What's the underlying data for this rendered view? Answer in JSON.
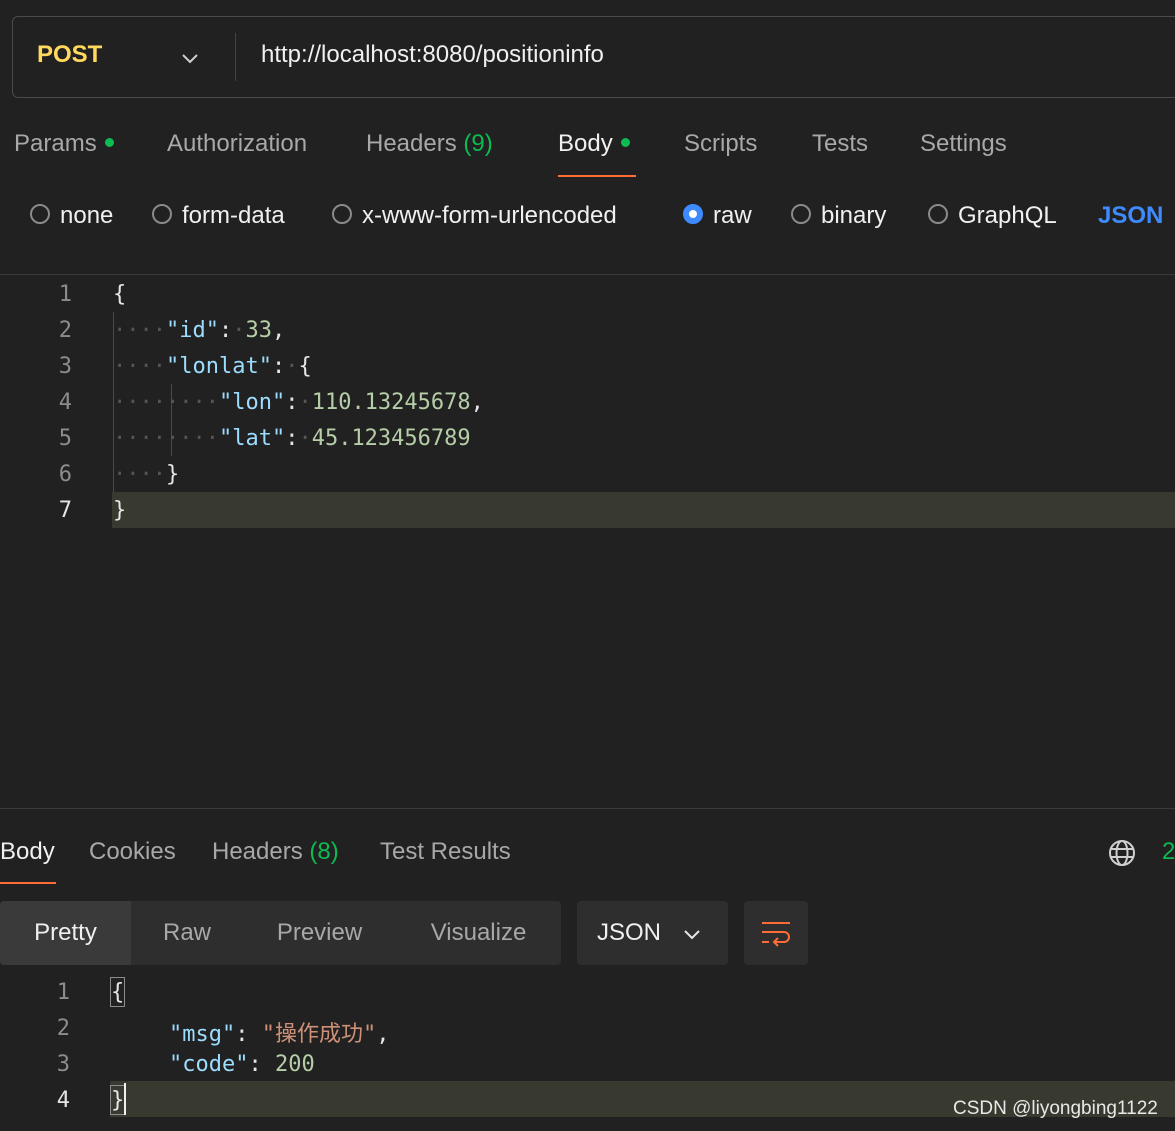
{
  "request": {
    "method": "POST",
    "url": "http://localhost:8080/positioninfo"
  },
  "request_tabs": [
    {
      "label": "Params",
      "dot": true
    },
    {
      "label": "Authorization"
    },
    {
      "label": "Headers",
      "count": "(9)"
    },
    {
      "label": "Body",
      "dot": true,
      "active": true
    },
    {
      "label": "Scripts"
    },
    {
      "label": "Tests"
    },
    {
      "label": "Settings"
    }
  ],
  "body_types": {
    "none": "none",
    "form_data": "form-data",
    "urlencoded": "x-www-form-urlencoded",
    "raw": "raw",
    "binary": "binary",
    "graphql": "GraphQL",
    "selected": "raw",
    "language": "JSON"
  },
  "request_body": {
    "line_numbers": [
      "1",
      "2",
      "3",
      "4",
      "5",
      "6",
      "7"
    ],
    "open_brace": "{",
    "close_brace": "}",
    "key_id": "\"id\"",
    "val_id": "33",
    "key_lonlat": "\"lonlat\"",
    "key_lon": "\"lon\"",
    "val_lon": "110.13245678",
    "key_lat": "\"lat\"",
    "val_lat": "45.123456789"
  },
  "response_tabs": [
    {
      "label": "Body",
      "active": true
    },
    {
      "label": "Cookies"
    },
    {
      "label": "Headers",
      "count": "(8)"
    },
    {
      "label": "Test Results"
    }
  ],
  "status_partial": "2",
  "view_modes": [
    "Pretty",
    "Raw",
    "Preview",
    "Visualize"
  ],
  "response_format": "JSON",
  "response_body": {
    "line_numbers": [
      "1",
      "2",
      "3",
      "4"
    ],
    "open_brace": "{",
    "close_brace": "}",
    "key_msg": "\"msg\"",
    "val_msg": "\"操作成功\"",
    "key_code": "\"code\"",
    "val_code": "200"
  },
  "watermark": "CSDN @liyongbing1122",
  "colors": {
    "method": "#ffd85e",
    "accent": "#ff6c37",
    "selected_radio": "#3d8bff",
    "dot": "#0cbb52"
  }
}
